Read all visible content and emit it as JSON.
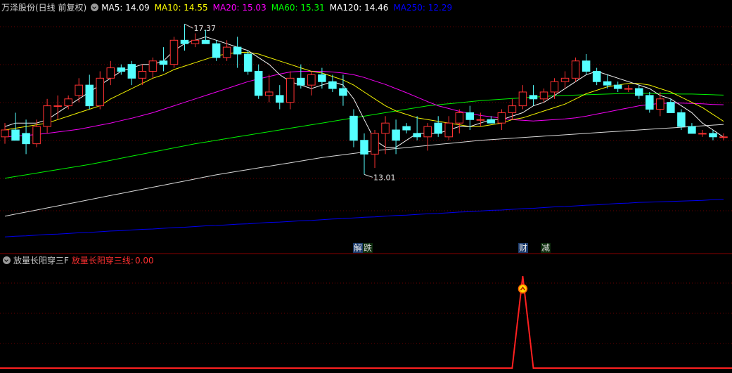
{
  "header": {
    "stock_name": "万泽股份(日线 前复权)",
    "ma": [
      {
        "label": "MA5:",
        "value": "14.09",
        "color": "#ffffff"
      },
      {
        "label": "MA10:",
        "value": "14.55",
        "color": "#ffff00"
      },
      {
        "label": "MA20:",
        "value": "15.03",
        "color": "#ff00ff"
      },
      {
        "label": "MA60:",
        "value": "15.31",
        "color": "#00ff00"
      },
      {
        "label": "MA120:",
        "value": "14.46",
        "color": "#ffffff"
      },
      {
        "label": "MA250:",
        "value": "12.29",
        "color": "#0000ff"
      }
    ]
  },
  "indicator_header": {
    "name": "放量长阳穿三F",
    "formula_label": "放量长阳穿三线:",
    "formula_value": "0.00"
  },
  "events": [
    {
      "text": "解",
      "style": "a"
    },
    {
      "text": "跌",
      "style": "b"
    },
    {
      "text": "财",
      "style": "a"
    },
    {
      "text": "减",
      "style": "b"
    }
  ],
  "chart_data": [
    {
      "type": "candlestick",
      "y_range": [
        10.9,
        17.7
      ],
      "grid": true,
      "annotations": [
        {
          "text": "17.37",
          "kind": "high"
        },
        {
          "text": "13.01",
          "kind": "low"
        }
      ],
      "candles": [
        [
          14.1,
          14.5,
          13.9,
          14.3
        ],
        [
          14.3,
          14.8,
          14.0,
          14.0
        ],
        [
          14.2,
          14.6,
          13.6,
          13.9
        ],
        [
          13.9,
          14.6,
          13.8,
          14.4
        ],
        [
          14.4,
          15.2,
          14.2,
          15.0
        ],
        [
          15.0,
          15.3,
          14.6,
          15.0
        ],
        [
          15.0,
          15.3,
          14.9,
          15.2
        ],
        [
          15.3,
          15.8,
          15.1,
          15.6
        ],
        [
          15.6,
          15.9,
          14.9,
          15.0
        ],
        [
          15.0,
          16.0,
          14.9,
          15.8
        ],
        [
          15.8,
          16.3,
          15.6,
          16.1
        ],
        [
          16.1,
          16.2,
          15.9,
          16.0
        ],
        [
          16.2,
          16.3,
          15.6,
          15.8
        ],
        [
          15.8,
          16.2,
          15.6,
          16.0
        ],
        [
          16.0,
          16.4,
          15.8,
          16.3
        ],
        [
          16.3,
          16.7,
          16.0,
          16.2
        ],
        [
          16.2,
          17.0,
          16.1,
          16.9
        ],
        [
          16.9,
          17.37,
          16.6,
          16.8
        ],
        [
          16.8,
          17.1,
          16.7,
          16.9
        ],
        [
          16.9,
          17.2,
          16.8,
          16.8
        ],
        [
          16.8,
          16.9,
          16.3,
          16.4
        ],
        [
          16.4,
          16.9,
          16.3,
          16.7
        ],
        [
          16.7,
          17.0,
          16.1,
          16.5
        ],
        [
          16.5,
          16.6,
          15.9,
          16.0
        ],
        [
          16.0,
          16.2,
          15.2,
          15.3
        ],
        [
          15.3,
          15.9,
          15.1,
          15.4
        ],
        [
          15.3,
          15.6,
          14.9,
          15.1
        ],
        [
          15.1,
          16.0,
          14.9,
          15.8
        ],
        [
          15.8,
          16.2,
          15.5,
          15.6
        ],
        [
          15.6,
          16.0,
          15.3,
          15.9
        ],
        [
          15.9,
          16.1,
          15.5,
          15.7
        ],
        [
          15.7,
          15.9,
          15.4,
          15.5
        ],
        [
          15.5,
          15.9,
          15.0,
          15.3
        ],
        [
          14.7,
          14.9,
          13.8,
          14.0
        ],
        [
          14.0,
          14.2,
          13.01,
          13.6
        ],
        [
          13.6,
          14.3,
          13.2,
          14.2
        ],
        [
          14.2,
          14.7,
          13.6,
          14.5
        ],
        [
          14.3,
          14.6,
          13.6,
          14.0
        ],
        [
          14.4,
          14.5,
          14.2,
          14.3
        ],
        [
          14.2,
          14.7,
          14.0,
          14.1
        ],
        [
          14.1,
          14.5,
          13.7,
          14.4
        ],
        [
          14.5,
          14.7,
          14.1,
          14.2
        ],
        [
          14.1,
          14.7,
          14.0,
          14.5
        ],
        [
          14.5,
          14.9,
          14.2,
          14.8
        ],
        [
          14.8,
          15.0,
          14.3,
          14.6
        ],
        [
          14.6,
          14.8,
          14.4,
          14.6
        ],
        [
          14.6,
          14.7,
          14.5,
          14.5
        ],
        [
          14.5,
          14.9,
          14.3,
          14.8
        ],
        [
          14.8,
          15.2,
          14.6,
          15.0
        ],
        [
          15.0,
          15.6,
          14.9,
          15.4
        ],
        [
          15.3,
          15.6,
          15.0,
          15.2
        ],
        [
          15.2,
          15.5,
          15.1,
          15.4
        ],
        [
          15.4,
          15.8,
          15.2,
          15.7
        ],
        [
          15.7,
          16.0,
          15.5,
          15.8
        ],
        [
          15.8,
          16.4,
          15.7,
          16.3
        ],
        [
          16.3,
          16.5,
          15.9,
          16.0
        ],
        [
          16.0,
          16.1,
          15.6,
          15.7
        ],
        [
          15.7,
          15.9,
          15.5,
          15.6
        ],
        [
          15.6,
          15.7,
          15.4,
          15.5
        ],
        [
          15.5,
          15.6,
          15.4,
          15.5
        ],
        [
          15.5,
          15.6,
          15.2,
          15.3
        ],
        [
          15.3,
          15.4,
          14.8,
          14.9
        ],
        [
          14.9,
          15.4,
          14.7,
          15.2
        ],
        [
          15.1,
          15.2,
          14.8,
          14.8
        ],
        [
          14.8,
          14.9,
          14.3,
          14.4
        ],
        [
          14.4,
          14.5,
          14.2,
          14.2
        ],
        [
          14.2,
          14.3,
          14.1,
          14.2
        ],
        [
          14.2,
          14.3,
          14.0,
          14.1
        ],
        [
          14.1,
          14.2,
          14.0,
          14.1
        ]
      ],
      "series": [
        {
          "name": "MA5",
          "color": "#ffffff",
          "values": [
            14.4,
            14.5,
            14.5,
            14.5,
            14.6,
            14.8,
            15.0,
            15.2,
            15.4,
            15.6,
            15.8,
            16.0,
            16.1,
            16.2,
            16.2,
            16.3,
            16.6,
            16.8,
            16.9,
            17.0,
            16.9,
            16.8,
            16.7,
            16.6,
            16.4,
            16.2,
            15.9,
            15.7,
            15.6,
            15.5,
            15.6,
            15.7,
            15.6,
            15.2,
            14.6,
            14.0,
            13.8,
            13.8,
            14.0,
            14.2,
            14.2,
            14.2,
            14.3,
            14.4,
            14.4,
            14.5,
            14.6,
            14.6,
            14.7,
            14.8,
            15.0,
            15.1,
            15.3,
            15.5,
            15.7,
            15.9,
            16.0,
            15.9,
            15.8,
            15.7,
            15.6,
            15.5,
            15.3,
            15.2,
            15.0,
            14.8,
            14.5,
            14.3,
            14.09
          ]
        },
        {
          "name": "MA10",
          "color": "#ffff00",
          "values": [
            14.3,
            14.35,
            14.4,
            14.45,
            14.5,
            14.6,
            14.7,
            14.8,
            14.9,
            15.0,
            15.2,
            15.35,
            15.5,
            15.65,
            15.8,
            15.9,
            16.05,
            16.15,
            16.25,
            16.35,
            16.45,
            16.5,
            16.55,
            16.55,
            16.5,
            16.4,
            16.3,
            16.2,
            16.1,
            16.0,
            15.95,
            15.85,
            15.75,
            15.6,
            15.4,
            15.2,
            15.0,
            14.85,
            14.75,
            14.65,
            14.6,
            14.55,
            14.5,
            14.45,
            14.4,
            14.4,
            14.45,
            14.5,
            14.6,
            14.65,
            14.75,
            14.85,
            14.95,
            15.05,
            15.2,
            15.35,
            15.45,
            15.55,
            15.6,
            15.65,
            15.65,
            15.6,
            15.5,
            15.4,
            15.25,
            15.1,
            14.95,
            14.75,
            14.55
          ]
        },
        {
          "name": "MA20",
          "color": "#ff00ff",
          "values": [
            14.1,
            14.12,
            14.14,
            14.17,
            14.2,
            14.24,
            14.28,
            14.32,
            14.38,
            14.44,
            14.5,
            14.57,
            14.64,
            14.72,
            14.8,
            14.9,
            15.0,
            15.1,
            15.2,
            15.3,
            15.4,
            15.5,
            15.6,
            15.7,
            15.78,
            15.85,
            15.92,
            15.98,
            16.0,
            16.0,
            16.0,
            15.98,
            15.95,
            15.9,
            15.82,
            15.72,
            15.62,
            15.5,
            15.38,
            15.25,
            15.12,
            15.0,
            14.92,
            14.84,
            14.78,
            14.72,
            14.68,
            14.64,
            14.6,
            14.58,
            14.56,
            14.58,
            14.6,
            14.62,
            14.65,
            14.7,
            14.76,
            14.82,
            14.88,
            14.94,
            15.0,
            15.04,
            15.07,
            15.08,
            15.08,
            15.07,
            15.06,
            15.04,
            15.03
          ]
        },
        {
          "name": "MA60",
          "color": "#00ff00",
          "values": [
            12.9,
            12.95,
            13.0,
            13.05,
            13.1,
            13.15,
            13.2,
            13.25,
            13.3,
            13.36,
            13.42,
            13.48,
            13.54,
            13.6,
            13.66,
            13.72,
            13.78,
            13.84,
            13.9,
            13.95,
            14.0,
            14.05,
            14.1,
            14.15,
            14.2,
            14.25,
            14.3,
            14.35,
            14.4,
            14.45,
            14.5,
            14.55,
            14.6,
            14.65,
            14.7,
            14.75,
            14.8,
            14.85,
            14.9,
            14.95,
            15.0,
            15.03,
            15.06,
            15.09,
            15.12,
            15.15,
            15.17,
            15.19,
            15.21,
            15.23,
            15.25,
            15.27,
            15.29,
            15.3,
            15.31,
            15.32,
            15.33,
            15.34,
            15.35,
            15.36,
            15.36,
            15.36,
            15.35,
            15.35,
            15.34,
            15.34,
            15.33,
            15.32,
            15.31
          ]
        },
        {
          "name": "MA120",
          "color": "#ffffff",
          "values": [
            11.8,
            11.86,
            11.92,
            11.98,
            12.04,
            12.1,
            12.16,
            12.22,
            12.28,
            12.34,
            12.4,
            12.46,
            12.52,
            12.58,
            12.64,
            12.7,
            12.76,
            12.82,
            12.88,
            12.94,
            13.0,
            13.05,
            13.1,
            13.15,
            13.2,
            13.25,
            13.3,
            13.35,
            13.4,
            13.45,
            13.5,
            13.54,
            13.58,
            13.62,
            13.66,
            13.7,
            13.73,
            13.76,
            13.79,
            13.82,
            13.85,
            13.88,
            13.91,
            13.94,
            13.97,
            14.0,
            14.02,
            14.04,
            14.06,
            14.08,
            14.1,
            14.12,
            14.14,
            14.16,
            14.18,
            14.2,
            14.22,
            14.24,
            14.26,
            14.28,
            14.3,
            14.32,
            14.34,
            14.36,
            14.38,
            14.4,
            14.42,
            14.44,
            14.46
          ]
        },
        {
          "name": "MA250",
          "color": "#0000ff",
          "values": [
            11.2,
            11.22,
            11.23,
            11.25,
            11.27,
            11.28,
            11.3,
            11.32,
            11.33,
            11.35,
            11.37,
            11.38,
            11.4,
            11.42,
            11.43,
            11.45,
            11.47,
            11.48,
            11.5,
            11.52,
            11.53,
            11.55,
            11.57,
            11.58,
            11.6,
            11.62,
            11.63,
            11.65,
            11.67,
            11.68,
            11.7,
            11.72,
            11.73,
            11.75,
            11.77,
            11.78,
            11.8,
            11.82,
            11.83,
            11.85,
            11.87,
            11.88,
            11.9,
            11.92,
            11.93,
            11.95,
            11.97,
            11.98,
            12.0,
            12.02,
            12.03,
            12.05,
            12.07,
            12.08,
            12.1,
            12.12,
            12.13,
            12.15,
            12.17,
            12.18,
            12.2,
            12.21,
            12.22,
            12.23,
            12.24,
            12.25,
            12.26,
            12.28,
            12.29
          ]
        }
      ]
    },
    {
      "type": "line",
      "name": "放量长阳穿三线",
      "color": "#ff2020",
      "y_range": [
        0,
        1.1
      ],
      "grid": true,
      "values": [
        0,
        0,
        0,
        0,
        0,
        0,
        0,
        0,
        0,
        0,
        0,
        0,
        0,
        0,
        0,
        0,
        0,
        0,
        0,
        0,
        0,
        0,
        0,
        0,
        0,
        0,
        0,
        0,
        0,
        0,
        0,
        0,
        0,
        0,
        0,
        0,
        0,
        0,
        0,
        0,
        0,
        0,
        0,
        0,
        0,
        0,
        0,
        0,
        0,
        0,
        0,
        0,
        0,
        0,
        0,
        0,
        0,
        0,
        0,
        0,
        0,
        0,
        0,
        0,
        0,
        0,
        0,
        0,
        0
      ],
      "signal_index": 49,
      "signal_value": 1
    }
  ]
}
